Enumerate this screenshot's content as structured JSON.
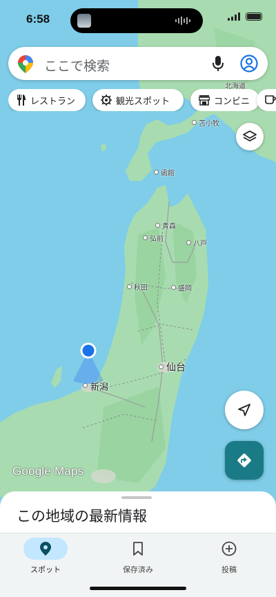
{
  "status_bar": {
    "time": "6:58"
  },
  "search": {
    "placeholder": "ここで検索"
  },
  "chips": [
    {
      "label": "レストラン",
      "icon": "restaurant-icon"
    },
    {
      "label": "観光スポット",
      "icon": "attraction-icon"
    },
    {
      "label": "コンビニ",
      "icon": "store-icon"
    }
  ],
  "map": {
    "labels": {
      "hokkaido": "北海道",
      "tomakomai": "苫小牧",
      "hakodate": "函館",
      "aomori": "青森",
      "hirosaki": "弘前",
      "hachinohe": "八戸",
      "akita": "秋田",
      "morioka": "盛岡",
      "sendai": "仙台",
      "niigata": "新潟"
    },
    "attribution": "Google Maps"
  },
  "bottom_sheet": {
    "title": "この地域の最新情報"
  },
  "nav": {
    "items": [
      {
        "label": "スポット",
        "icon": "location-pin-icon",
        "active": true
      },
      {
        "label": "保存済み",
        "icon": "bookmark-icon",
        "active": false
      },
      {
        "label": "投稿",
        "icon": "add-circle-icon",
        "active": false
      }
    ]
  },
  "colors": {
    "water": "#7fcde8",
    "land": "#a8dcb0",
    "accent_teal": "#1a7a85",
    "active_nav": "#c2e7ff",
    "user_location": "#1a73e8"
  }
}
